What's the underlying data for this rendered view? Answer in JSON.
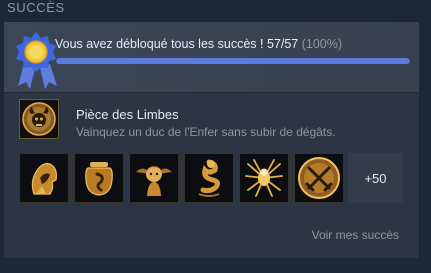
{
  "section": {
    "title": "SUCCÈS"
  },
  "summary": {
    "text": "Vous avez débloqué tous les succès ! 57/57",
    "percent_label": "(100%)",
    "progress": 1.0
  },
  "featured": {
    "name": "Pièce des Limbes",
    "description": "Vainquez un duc de l'Enfer sans subir de dégâts.",
    "icon": "skull-horns-icon"
  },
  "achievements": [
    {
      "icon": "hooded-figure-icon"
    },
    {
      "icon": "jar-worm-icon"
    },
    {
      "icon": "winged-girl-icon"
    },
    {
      "icon": "serpent-icon"
    },
    {
      "icon": "spider-icon"
    },
    {
      "icon": "crossed-swords-icon"
    }
  ],
  "more_label": "+50",
  "view_all_label": "Voir mes succès",
  "colors": {
    "progress": "#5d7bdb",
    "gold": "#d9a441",
    "panel": "#2b3544"
  }
}
